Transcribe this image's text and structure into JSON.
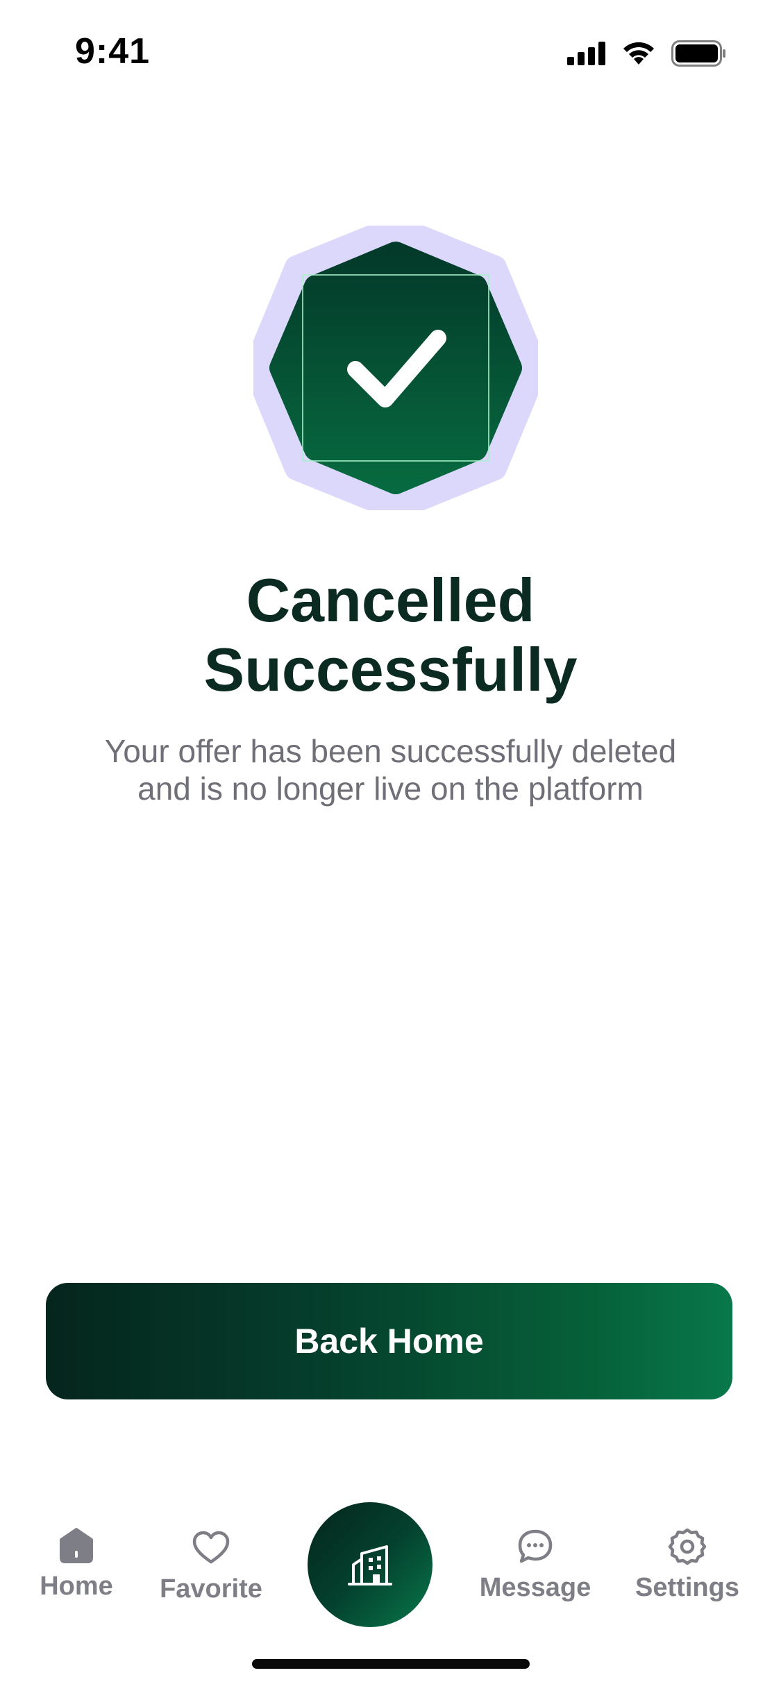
{
  "status_bar": {
    "time": "9:41"
  },
  "badge": {
    "icon": "checkmark-icon",
    "outer_color": "#dcd8fc",
    "inner_color_top": "#033a2a",
    "inner_color_bottom": "#07693f"
  },
  "content": {
    "title_line1": "Cancelled",
    "title_line2": "Successfully",
    "subtitle": "Your offer has been successfully deleted and is no longer live on the platform"
  },
  "actions": {
    "back_home_label": "Back Home"
  },
  "tab_bar": {
    "items": [
      {
        "label": "Home",
        "icon": "home-icon"
      },
      {
        "label": "Favorite",
        "icon": "heart-icon"
      },
      {
        "label": "",
        "icon": "building-icon"
      },
      {
        "label": "Message",
        "icon": "chat-bubble-icon"
      },
      {
        "label": "Settings",
        "icon": "gear-icon"
      }
    ]
  },
  "colors": {
    "accent_dark": "#05251d",
    "accent_green": "#08784a",
    "muted_text": "#6f6f78",
    "tab_inactive": "#7e7e86"
  }
}
